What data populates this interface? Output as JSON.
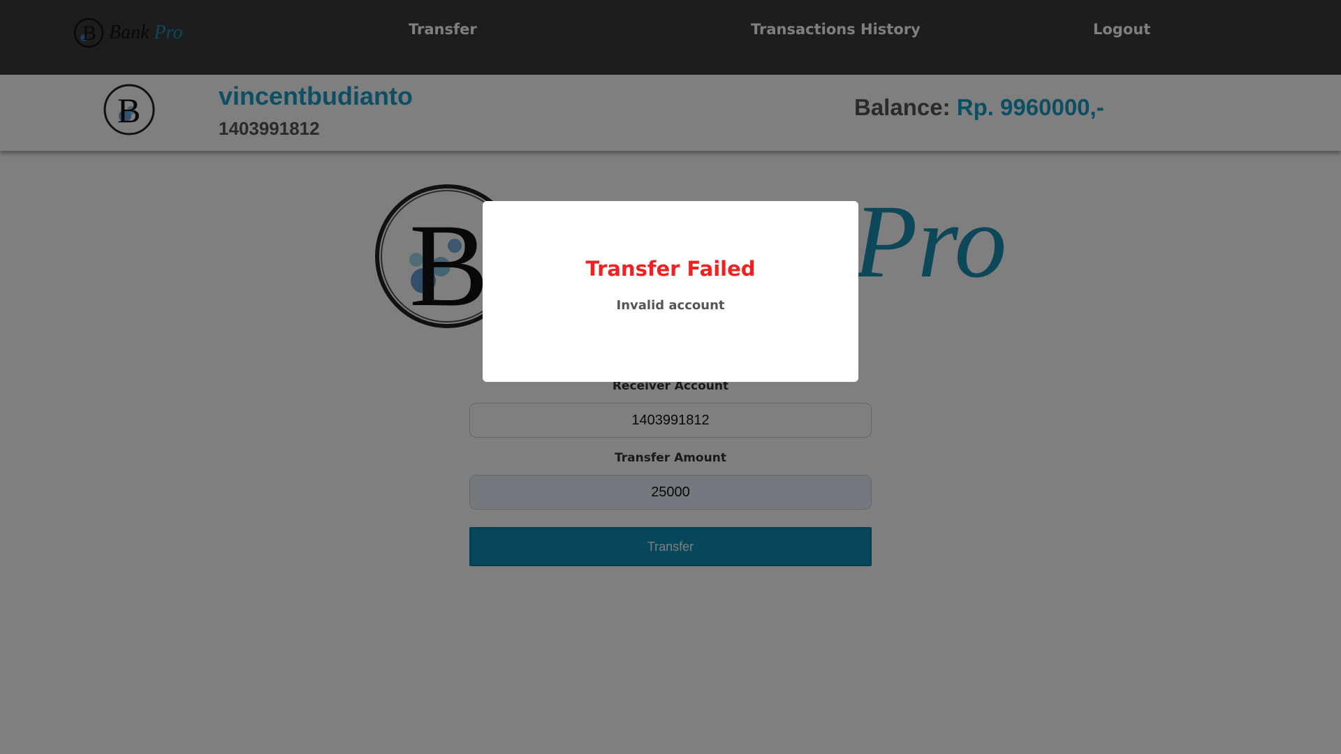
{
  "navbar": {
    "logo_text": "Bank",
    "logo_text_accent": "Pro",
    "links": [
      "Transfer",
      "Transactions History",
      "Logout"
    ]
  },
  "profile": {
    "username": "vincentbudianto",
    "account_number": "1403991812",
    "balance_label": "Balance:",
    "balance_value": "Rp. 9960000,-"
  },
  "main": {
    "logo_text_accent": "Pro",
    "receiver_label": "Receiver Account",
    "receiver_value": "1403991812",
    "amount_label": "Transfer Amount",
    "amount_value": "25000",
    "transfer_button_label": "Transfer"
  },
  "modal": {
    "title": "Transfer Failed",
    "message": "Invalid account"
  },
  "colors": {
    "accent": "#1a9cc7",
    "navbar": "#3a3a3a",
    "error": "#ee2222"
  }
}
